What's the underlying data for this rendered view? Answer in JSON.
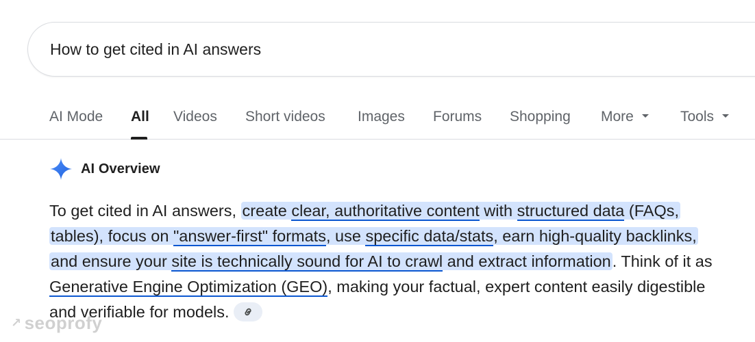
{
  "search": {
    "query": "How to get cited in AI answers"
  },
  "tabs": [
    {
      "label": "AI Mode"
    },
    {
      "label": "All"
    },
    {
      "label": "Videos"
    },
    {
      "label": "Short videos"
    },
    {
      "label": "Images"
    },
    {
      "label": "Forums"
    },
    {
      "label": "Shopping"
    },
    {
      "label": "More"
    },
    {
      "label": "Tools"
    }
  ],
  "active_tab": "All",
  "ai_overview": {
    "title": "AI Overview",
    "icon": "sparkle-icon",
    "answer": {
      "intro": "To get cited in AI answers, ",
      "create": "create ",
      "clear_content": "clear, authoritative content",
      "with": " with ",
      "structured_data": "structured data",
      "faqs_focus": " (FAQs, tables), focus on ",
      "answer_first": "\"answer-first\" formats",
      "use": ", use ",
      "specific_data": "specific data/stats",
      "earn_backlinks": ", earn high-quality backlinks",
      "and_ensure": ", and ensure your ",
      "site_sound": "site is technically sound for AI to crawl",
      "extract": " and extract information",
      "think": ". Think of it as ",
      "geo": "Generative Engine Optimization (GEO)",
      "ending": ", making your factual, expert content easily digestible and verifiable for models."
    },
    "link_icon": "link-icon"
  },
  "watermark": {
    "text": "seoprofy"
  },
  "colors": {
    "highlight": "#d3e3fd",
    "underline": "#0b57d0",
    "sparkle": "#4285f4"
  }
}
